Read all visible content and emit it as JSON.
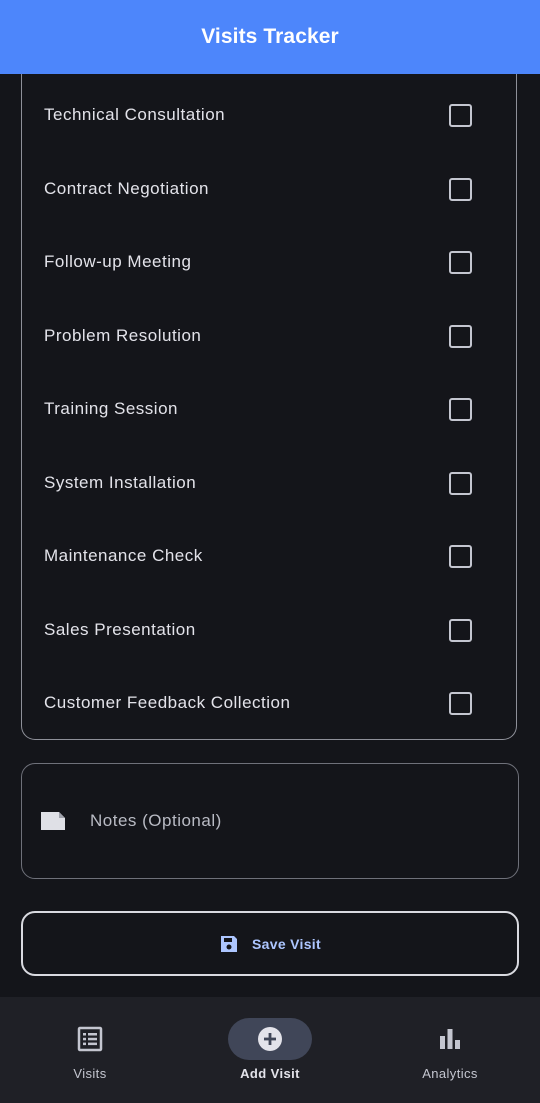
{
  "app_bar": {
    "title": "Visits Tracker"
  },
  "purposes": {
    "items": [
      {
        "label": "Technical Consultation",
        "checked": false
      },
      {
        "label": "Contract Negotiation",
        "checked": false
      },
      {
        "label": "Follow-up Meeting",
        "checked": false
      },
      {
        "label": "Problem Resolution",
        "checked": false
      },
      {
        "label": "Training Session",
        "checked": false
      },
      {
        "label": "System Installation",
        "checked": false
      },
      {
        "label": "Maintenance Check",
        "checked": false
      },
      {
        "label": "Sales Presentation",
        "checked": false
      },
      {
        "label": "Customer Feedback Collection",
        "checked": false
      }
    ]
  },
  "notes": {
    "placeholder": "Notes (Optional)",
    "value": "",
    "icon": "note-icon"
  },
  "save_button": {
    "label": "Save Visit",
    "icon": "floppy-disk-icon"
  },
  "bottom_nav": {
    "items": [
      {
        "label": "Visits",
        "icon": "list-icon",
        "active": false
      },
      {
        "label": "Add Visit",
        "icon": "add-circle-icon",
        "active": true
      },
      {
        "label": "Analytics",
        "icon": "bar-chart-icon",
        "active": false
      }
    ]
  },
  "colors": {
    "app_bar": "#4d86fb",
    "background": "#14151a",
    "accent": "#adc6ff",
    "nav_background": "#1f2026",
    "nav_active_pill": "#404658"
  }
}
